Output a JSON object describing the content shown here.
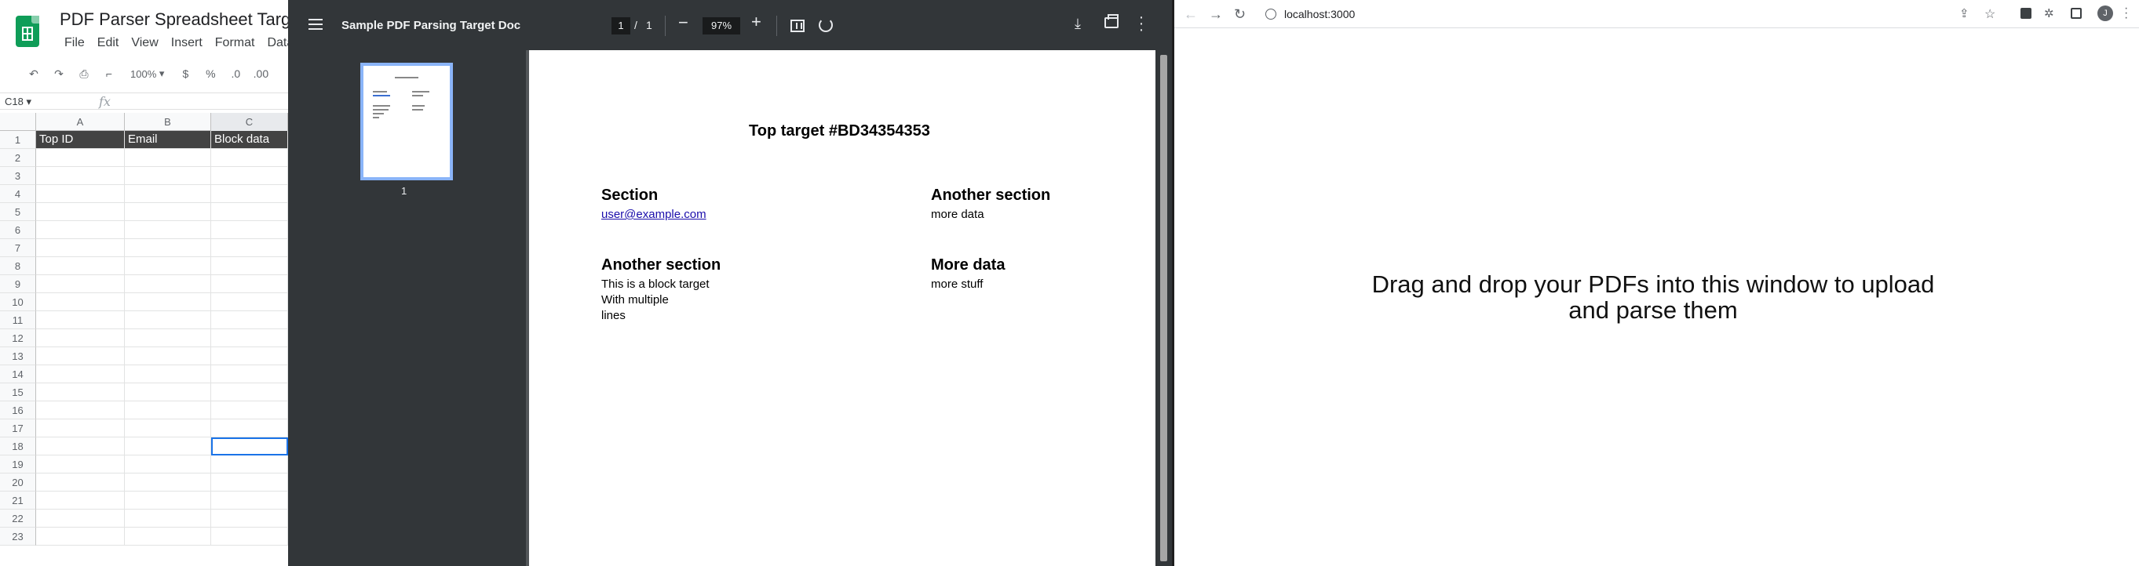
{
  "sheets": {
    "title": "PDF Parser Spreadsheet Target",
    "menu": [
      "File",
      "Edit",
      "View",
      "Insert",
      "Format",
      "Data"
    ],
    "toolbar": {
      "zoom": "100%",
      "currency": "$",
      "percent": "%",
      "dec_less": ".0",
      "dec_more": ".00"
    },
    "name_box": "C18",
    "fx": "fx",
    "columns": [
      "A",
      "B",
      "C"
    ],
    "headers": [
      "Top ID",
      "Email",
      "Block data"
    ],
    "rows": [
      "1",
      "2",
      "3",
      "4",
      "5",
      "6",
      "7",
      "8",
      "9",
      "10",
      "11",
      "12",
      "13",
      "14",
      "15",
      "16",
      "17",
      "18",
      "19",
      "20",
      "21",
      "22",
      "23"
    ],
    "selected_cell": "C18"
  },
  "pdf": {
    "title": "Sample PDF Parsing Target Doc",
    "page_current": "1",
    "page_sep": "/",
    "page_total": "1",
    "zoom": "97%",
    "thumb_label": "1",
    "content": {
      "heading": "Top target #BD34354353",
      "s1_title": "Section",
      "s1_link": "user@example.com",
      "s2_title": "Another section",
      "s2_text": "more data",
      "s3_title": "Another section",
      "s3_line1": "This is a block target",
      "s3_line2": "With multiple",
      "s3_line3": "lines",
      "s4_title": "More data",
      "s4_text": "more stuff"
    }
  },
  "browser": {
    "url": "localhost:3000",
    "avatar_letter": "J",
    "drop_message_line1": "Drag and drop your PDFs into this window to upload",
    "drop_message_line2": "and parse them"
  },
  "colors": {
    "sheets_green": "#0f9d58",
    "header_fill": "#434343",
    "pdf_bar": "#323639",
    "pdf_bg": "#525659",
    "selection": "#1a73e8"
  }
}
